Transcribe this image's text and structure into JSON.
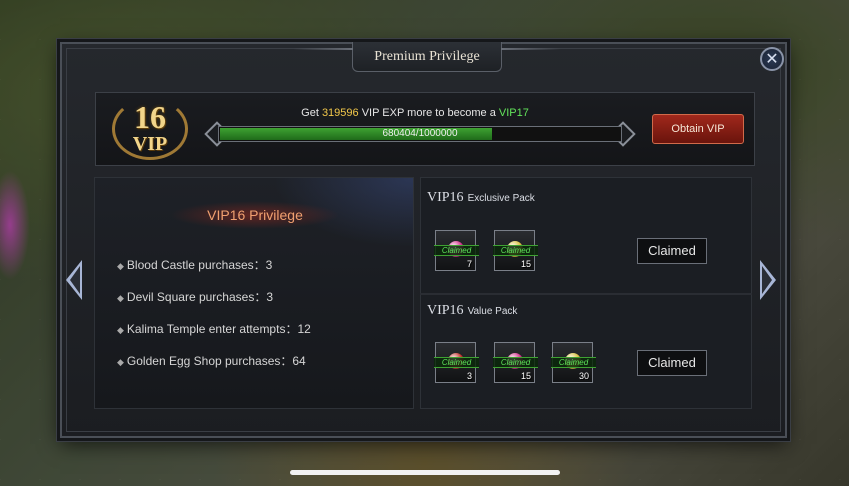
{
  "window": {
    "title": "Premium Privilege",
    "close_glyph": "✕"
  },
  "vip": {
    "level_number": "16",
    "level_label": "VIP",
    "msg_prefix": "Get ",
    "exp_needed": "319596",
    "msg_middle": " VIP EXP more to become a ",
    "next_vip": "VIP17",
    "progress_text": "680404/1000000",
    "progress_fraction": 0.680404,
    "obtain_label": "Obtain VIP"
  },
  "privilege": {
    "title": "VIP16 Privilege",
    "items": [
      "Blood Castle purchases：3",
      "Devil Square purchases：3",
      "Kalima Temple enter attempts：12",
      "Golden Egg Shop purchases：64"
    ]
  },
  "packs": [
    {
      "title": "VIP16",
      "subtitle": "Exclusive Pack",
      "button": "Claimed",
      "items": [
        {
          "tag": "Claimed",
          "qty": "7",
          "color": "#d0308a"
        },
        {
          "tag": "Claimed",
          "qty": "15",
          "color": "#d8c040"
        }
      ]
    },
    {
      "title": "VIP16",
      "subtitle": "Value Pack",
      "button": "Claimed",
      "items": [
        {
          "tag": "Claimed",
          "qty": "3",
          "color": "#c0302a"
        },
        {
          "tag": "Claimed",
          "qty": "15",
          "color": "#d0308a"
        },
        {
          "tag": "Claimed",
          "qty": "30",
          "color": "#d8c040"
        }
      ]
    }
  ]
}
